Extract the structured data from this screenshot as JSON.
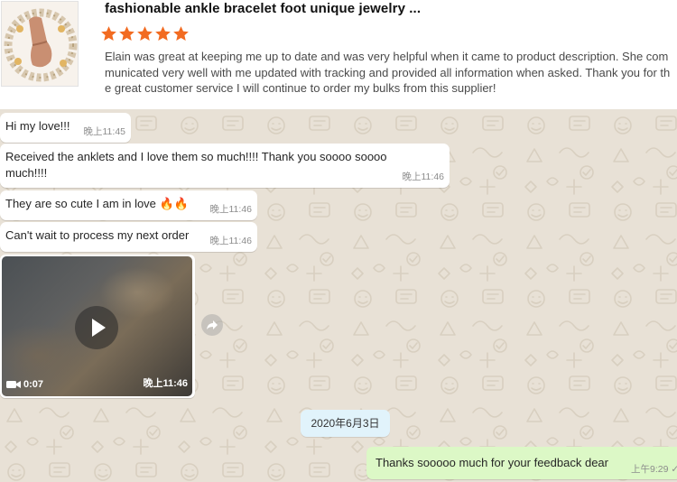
{
  "review": {
    "product_title": "fashionable ankle bracelet foot unique jewelry ...",
    "rating": 5,
    "star_color": "#f26b21",
    "text": "Elain was great at keeping me up to date and was very helpful when it came to product description. She communicated very well with me updated with tracking and provided all information when asked. Thank you for the great customer service I will continue to order my bulks from this supplier!",
    "thumbnail_icon": "product-photo-thumbnail"
  },
  "chat": {
    "wallpaper_color": "#e8e1d6",
    "messages": [
      {
        "text": "Hi my love!!!",
        "time": "晚上11:45"
      },
      {
        "text": "Received the anklets and I love them so much!!!! Thank you soooo soooo much!!!!",
        "time": "晚上11:46"
      },
      {
        "text": "They are so cute I am in love 🔥🔥",
        "time": "晚上11:46"
      },
      {
        "text": "Can't wait to process my next order",
        "time": "晚上11:46"
      }
    ],
    "video": {
      "duration": "0:07",
      "time": "晚上11:46"
    },
    "date_chip": "2020年6月3日",
    "outgoing": {
      "text": "Thanks sooooo much for your feedback dear",
      "time": "上午9:29 ✓"
    }
  }
}
